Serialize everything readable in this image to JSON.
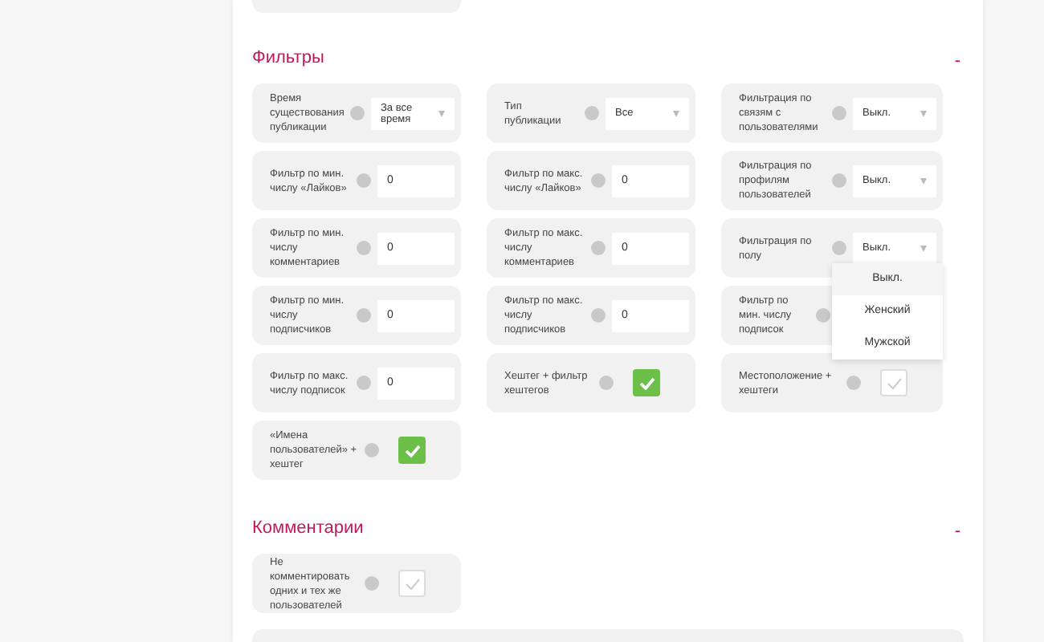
{
  "sections": [
    {
      "title": "Фильтры",
      "toggle": "-",
      "fields": [
        {
          "kind": "select",
          "label": "Время существования публикации",
          "value": "За все время"
        },
        {
          "kind": "select",
          "label": "Тип публикации",
          "value": "Все"
        },
        {
          "kind": "select",
          "label": "Фильтрация по связям с пользователями",
          "value": "Выкл."
        },
        {
          "kind": "number",
          "label": "Фильтр по мин. числу «Лайков»",
          "value": "0"
        },
        {
          "kind": "number",
          "label": "Фильтр по макс. числу «Лайков»",
          "value": "0"
        },
        {
          "kind": "select",
          "label": "Фильтрация по профилям пользователей",
          "value": "Выкл."
        },
        {
          "kind": "number",
          "label": "Фильтр по мин. числу комментариев",
          "value": "0"
        },
        {
          "kind": "number",
          "label": "Фильтр по макс. числу комментариев",
          "value": "0"
        },
        {
          "kind": "select",
          "label": "Фильтрация по полу",
          "value": "Выкл.",
          "expanded": true,
          "options": [
            {
              "label": "Выкл.",
              "selected": true
            },
            {
              "label": "Женский",
              "selected": false
            },
            {
              "label": "Мужской",
              "selected": false
            }
          ]
        },
        {
          "kind": "number",
          "label": "Фильтр по мин. числу подписчиков",
          "value": "0"
        },
        {
          "kind": "number",
          "label": "Фильтр по макс. числу подписчиков",
          "value": "0"
        },
        {
          "kind": "number",
          "label": "Фильтр по мин. числу подписок"
        },
        {
          "kind": "number",
          "label": "Фильтр по макс. числу подписок",
          "value": "0"
        },
        {
          "kind": "checkbox",
          "label": "Хештег + фильтр хештегов",
          "checked": true
        },
        {
          "kind": "checkbox",
          "label": "Местоположение + хештеги",
          "checked": false
        },
        {
          "kind": "checkbox",
          "label": "«Имена пользователей» + хештег",
          "checked": true
        }
      ]
    },
    {
      "title": "Комментарии",
      "toggle": "-",
      "fields": [
        {
          "kind": "checkbox",
          "label": "Не комментировать одних и тех же пользователей",
          "checked": false
        }
      ]
    }
  ]
}
